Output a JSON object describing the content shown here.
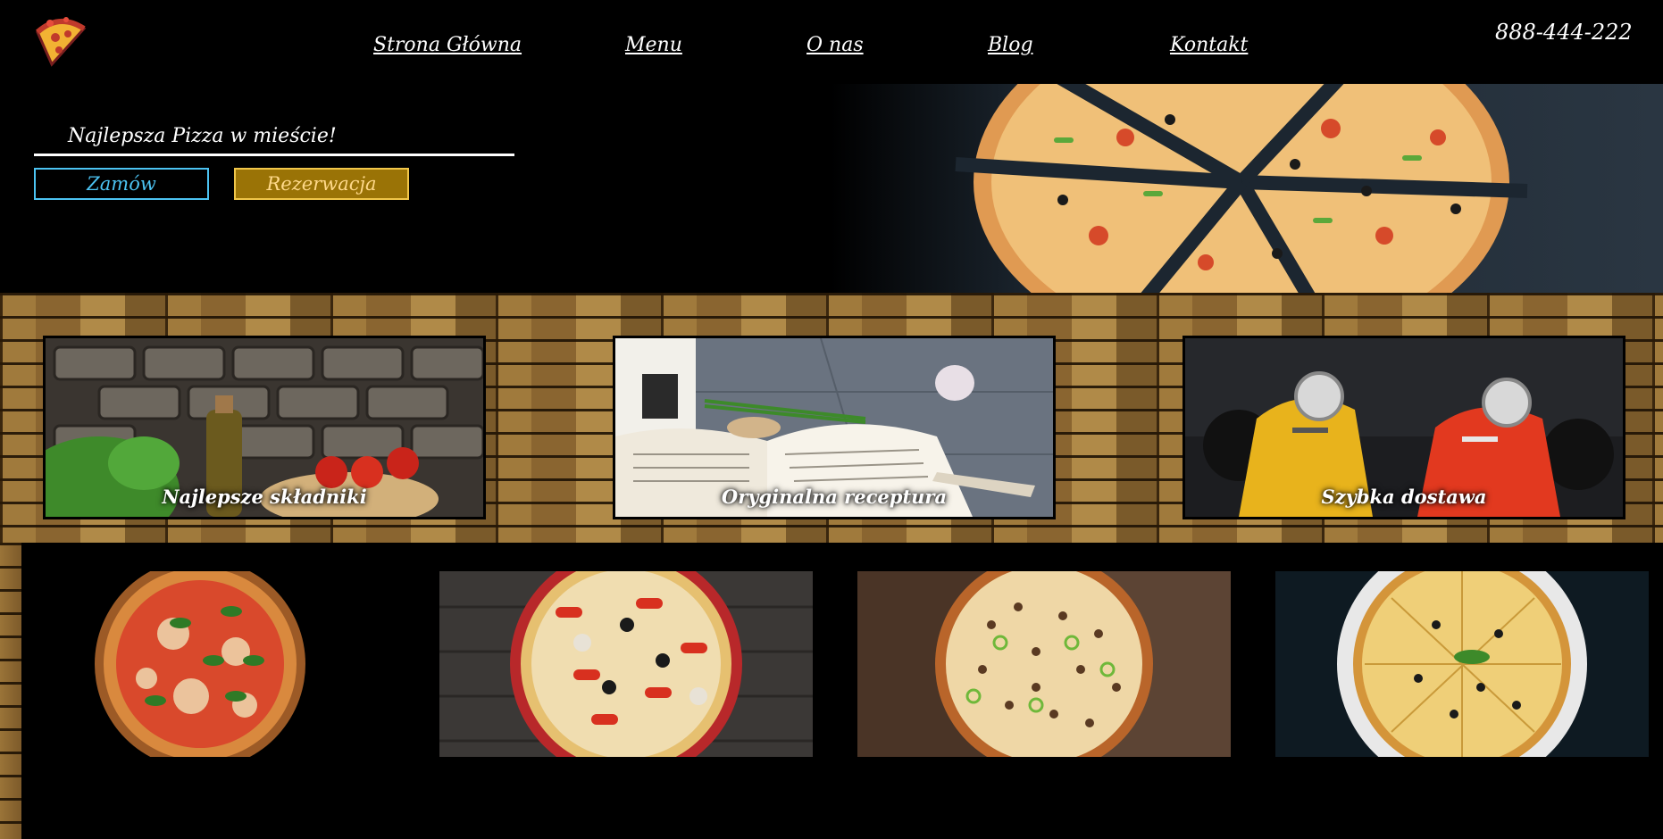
{
  "header": {
    "logo_icon": "pizza-slice-icon",
    "phone": "888-444-222",
    "nav": [
      {
        "label": "Strona Główna"
      },
      {
        "label": "Menu"
      },
      {
        "label": "O nas"
      },
      {
        "label": "Blog"
      },
      {
        "label": "Kontakt"
      }
    ]
  },
  "hero": {
    "tagline": "Najlepsza Pizza w mieście!",
    "order_label": "Zamów",
    "reserve_label": "Rezerwacja"
  },
  "features": [
    {
      "title": "Najlepsze składniki"
    },
    {
      "title": "Oryginalna receptura"
    },
    {
      "title": "Szybka dostawa"
    }
  ],
  "colors": {
    "accent_blue": "#4cc3f2",
    "accent_gold": "#9a7306",
    "background": "#000000"
  }
}
